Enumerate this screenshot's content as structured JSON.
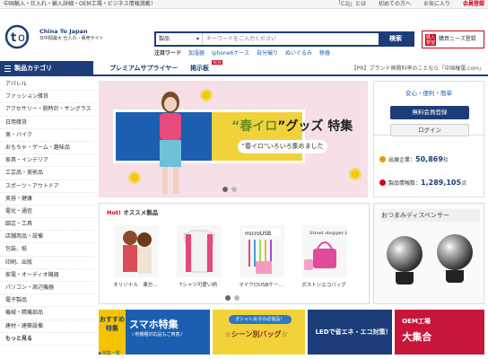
{
  "topbar": {
    "left": "中国輸入・仕入れ・輸入詳細・OEM工場・ビジネス情報満載！",
    "links": [
      "「C2J」とは",
      "初めての方へ",
      "お気に入り",
      "会員登録"
    ]
  },
  "logo": {
    "en": "China To Japan",
    "jp": "日中間最大 仕入れ・販売サイト"
  },
  "search": {
    "category": "製品",
    "placeholder": "キーワードをご入力ください",
    "button": "検索"
  },
  "request_button": {
    "icon": "購入要望",
    "label": "購買ニーズ登録"
  },
  "keywords": {
    "heading": "注目ワード",
    "items": [
      "加湿器",
      "iphone6ケース",
      "自分撮り",
      "ぬいぐるみ",
      "移器"
    ]
  },
  "nav": {
    "category_button": "製品カテゴリ",
    "items": [
      "プレミアムサプライヤー",
      "掲示板"
    ],
    "new_badge": "NEW",
    "pr": "【PR】ブランド興費料率のことなら「中国権電.com」"
  },
  "sidebar": {
    "items": [
      "アパレル",
      "ファッション雑貨",
      "アクセサリー・腕時計・サングラス",
      "日用雑貨",
      "車・バイク",
      "おもちゃ・ゲーム・趣味品",
      "家具・インテリア",
      "工芸品・美術品",
      "スポーツ・アウトドア",
      "美容・健康",
      "電化・通信",
      "園芸・工具",
      "店舗用品・設備",
      "包装、紙",
      "印刷、出版",
      "家電・オーディオ機器",
      "パソコン・周辺機器",
      "電子製品",
      "機械・精機部品",
      "建材・建築設備",
      "もっと見る"
    ]
  },
  "hero": {
    "title_pre": "“",
    "title_accent": "春イロ",
    "title_post": "”グッズ 特集",
    "pill": "“春イロ”いろいろ集めました"
  },
  "right_panel": {
    "tagline": "安心・便利・簡単",
    "register": "無料会員登録",
    "login": "ログイン",
    "stats": [
      {
        "label": "出展企業：",
        "value": "50,869",
        "unit": "社"
      },
      {
        "label": "製品情報数：",
        "value": "1,289,105",
        "unit": "点"
      }
    ]
  },
  "osusume": {
    "hot": "Hot!",
    "title": "オススメ製品",
    "products": [
      "オリジナル　東方...",
      "Tシャツ可愛い柄",
      "マイクロUSBケー...",
      "ボストンエコバッグ"
    ]
  },
  "ad": {
    "title": "おつまみディスペンサー"
  },
  "banners": {
    "b1_tag": "おすすめ特集",
    "b1_big": "スマホ特集",
    "b1_sm": "☆他機種対応品もご用意♪",
    "b2_sub": "オシャレ女子の必需品！",
    "b2_big": "☆シーン別バッグ☆",
    "b3_big": "LEDで省エネ・エコ対策！",
    "b4_t1": "OEM工場",
    "b4_t2": "大集合",
    "more": "▶特集一覧"
  }
}
